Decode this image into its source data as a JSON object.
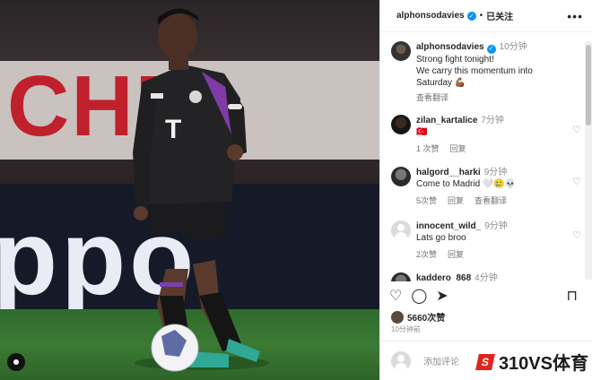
{
  "post": {
    "photo_banner_text": "CHE",
    "photo_board_text": "ppo",
    "jersey_name": "T"
  },
  "header": {
    "username": "alphonsodavies",
    "separator": "•",
    "follow_state": "已关注",
    "more": "•••"
  },
  "caption": {
    "username": "alphonsodavies",
    "time": "10分钟",
    "lines": [
      "Strong fight tonight!",
      "We carry this momentum into",
      "Saturday 💪🏾"
    ],
    "translate": "查看翻译"
  },
  "comments": [
    {
      "username": "zilan_kartalice",
      "time": "7分钟",
      "text": "🇹🇷",
      "likes": "1 次赞",
      "reply": "回复",
      "translate": ""
    },
    {
      "username": "halgord__harki",
      "time": "9分钟",
      "text": "Come to Madrid 🤍🥲💀",
      "likes": "5次赞",
      "reply": "回复",
      "translate": "查看翻译"
    },
    {
      "username": "innocent_wild_",
      "time": "9分钟",
      "text": "Lats go broo",
      "likes": "2次赞",
      "reply": "回复",
      "translate": ""
    },
    {
      "username": "kaddero_868",
      "time": "4分钟",
      "text": "",
      "likes": "",
      "reply": "",
      "translate": ""
    }
  ],
  "actions": {
    "like": "♡",
    "comment": "◯",
    "share": "➤",
    "save": "⊓"
  },
  "likes_count": "5660次赞",
  "posted_time": "10分钟前",
  "add_comment": {
    "placeholder": "添加评论"
  },
  "watermark": {
    "logo": "S",
    "text": "310VS体育"
  },
  "colors": {
    "accent": "#0095f6",
    "brand_red": "#e2231a",
    "kit": "#1d1d1f",
    "kit_trim": "#8a3fb5"
  }
}
